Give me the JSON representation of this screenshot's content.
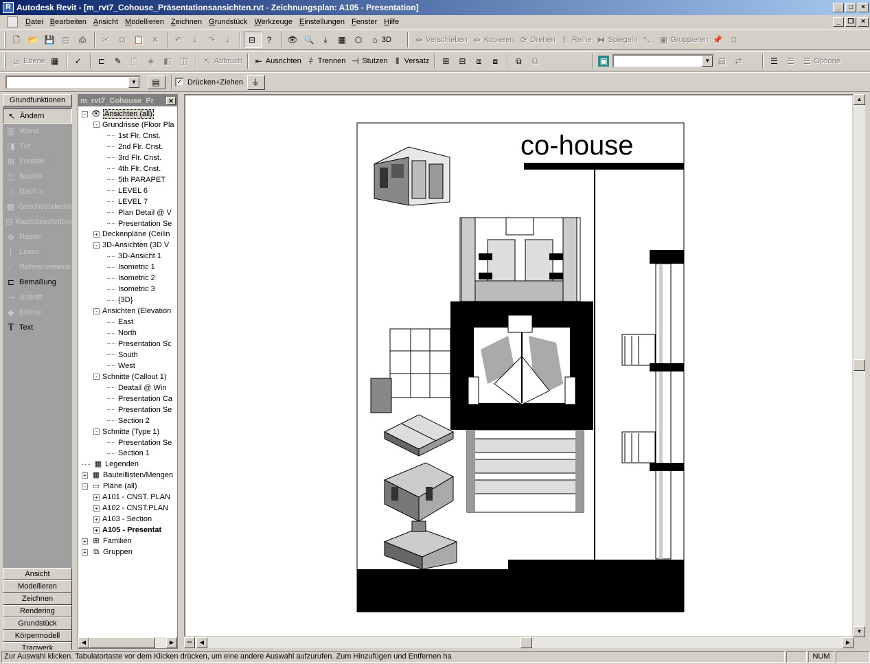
{
  "window": {
    "title": "Autodesk Revit - [m_rvt7_Cohouse_Präsentationsansichten.rvt - Zeichnungsplan: A105 - Presentation]",
    "app_icon": "R"
  },
  "menu": [
    "Datei",
    "Bearbeiten",
    "Ansicht",
    "Modellieren",
    "Zeichnen",
    "Grundstück",
    "Werkzeuge",
    "Einstellungen",
    "Fenster",
    "Hilfe"
  ],
  "toolbar1": {
    "view_3d_label": "3D",
    "verschieben": "Verschieben",
    "kopieren": "Kopieren",
    "drehen": "Drehen",
    "reihe": "Reihe",
    "spiegeln": "Spiegeln",
    "gruppieren": "Gruppieren"
  },
  "toolbar2": {
    "ebene": "Ebene",
    "abbruch": "Abbruch",
    "ausrichten": "Ausrichten",
    "trennen": "Trennen",
    "stutzen": "Stutzen",
    "versatz": "Versatz",
    "optionen": "Optione"
  },
  "toolbar3": {
    "druecken_ziehen": "Drücken+Ziehen",
    "druecken_ziehen_checked": true
  },
  "designbar": {
    "header": "Grundfunktionen",
    "items": [
      {
        "label": "Ändern",
        "state": "selected",
        "icon": "cursor-icon"
      },
      {
        "label": "Wand",
        "state": "disabled",
        "icon": "wall-icon"
      },
      {
        "label": "Tür",
        "state": "disabled",
        "icon": "door-icon"
      },
      {
        "label": "Fenster",
        "state": "disabled",
        "icon": "window-icon"
      },
      {
        "label": "Bauteil",
        "state": "disabled",
        "icon": "component-icon"
      },
      {
        "label": "Dach »",
        "state": "disabled",
        "icon": "roof-icon"
      },
      {
        "label": "Geschossdecke",
        "state": "disabled",
        "icon": "floor-icon"
      },
      {
        "label": "Raumbeschriftung",
        "state": "disabled",
        "icon": "room-tag-icon"
      },
      {
        "label": "Raster",
        "state": "disabled",
        "icon": "grid-icon"
      },
      {
        "label": "Linien",
        "state": "disabled",
        "icon": "lines-icon"
      },
      {
        "label": "Referenzebene",
        "state": "disabled",
        "icon": "ref-plane-icon"
      },
      {
        "label": "Bemaßung",
        "state": "active",
        "icon": "dimension-icon"
      },
      {
        "label": "Schnitt",
        "state": "disabled",
        "icon": "section-icon"
      },
      {
        "label": "Ebene",
        "state": "disabled",
        "icon": "level-icon"
      },
      {
        "label": "Text",
        "state": "active",
        "icon": "text-icon"
      }
    ],
    "tabs": [
      "Ansicht",
      "Modellieren",
      "Zeichnen",
      "Rendering",
      "Grundstück",
      "Körpermodell",
      "Tragwerk"
    ]
  },
  "browser": {
    "title": "m_rvt7_Cohouse_Pr",
    "tree": [
      {
        "label": "Ansichten (all)",
        "level": 0,
        "toggle": "-",
        "icon": "eye-icon",
        "selected": true
      },
      {
        "label": "Grundrisse (Floor Pla",
        "level": 1,
        "toggle": "-"
      },
      {
        "label": "1st Flr. Cnst.",
        "level": 2
      },
      {
        "label": "2nd Flr. Cnst.",
        "level": 2
      },
      {
        "label": "3rd Flr. Cnst.",
        "level": 2
      },
      {
        "label": "4th Flr. Cnst.",
        "level": 2
      },
      {
        "label": "5th PARAPET",
        "level": 2
      },
      {
        "label": "LEVEL 6",
        "level": 2
      },
      {
        "label": "LEVEL 7",
        "level": 2
      },
      {
        "label": "Plan Detail @ V",
        "level": 2
      },
      {
        "label": "Presentation Se",
        "level": 2
      },
      {
        "label": "Deckenpläne (Ceilin",
        "level": 1,
        "toggle": "+"
      },
      {
        "label": "3D-Ansichten (3D V",
        "level": 1,
        "toggle": "-"
      },
      {
        "label": "3D-Ansicht 1",
        "level": 2
      },
      {
        "label": "Isometric 1",
        "level": 2
      },
      {
        "label": "Isometric 2",
        "level": 2
      },
      {
        "label": "Isometric 3",
        "level": 2
      },
      {
        "label": "{3D}",
        "level": 2
      },
      {
        "label": "Ansichten (Elevation",
        "level": 1,
        "toggle": "-"
      },
      {
        "label": "East",
        "level": 2
      },
      {
        "label": "North",
        "level": 2
      },
      {
        "label": "Presentation Sc",
        "level": 2
      },
      {
        "label": "South",
        "level": 2
      },
      {
        "label": "West",
        "level": 2
      },
      {
        "label": "Schnitte (Callout 1)",
        "level": 1,
        "toggle": "-"
      },
      {
        "label": "Deatail @ Win",
        "level": 2
      },
      {
        "label": "Presentation Ca",
        "level": 2
      },
      {
        "label": "Presentation Se",
        "level": 2
      },
      {
        "label": "Section 2",
        "level": 2
      },
      {
        "label": "Schnitte (Type 1)",
        "level": 1,
        "toggle": "-"
      },
      {
        "label": "Presentation Se",
        "level": 2
      },
      {
        "label": "Section 1",
        "level": 2
      },
      {
        "label": "Legenden",
        "level": 0,
        "icon": "legend-icon"
      },
      {
        "label": "Bauteillisten/Mengen",
        "level": 0,
        "toggle": "+",
        "icon": "schedule-icon"
      },
      {
        "label": "Pläne (all)",
        "level": 0,
        "toggle": "-",
        "icon": "sheet-icon"
      },
      {
        "label": "A101 - CNST. PLAN",
        "level": 1,
        "toggle": "+"
      },
      {
        "label": "A102 - CNST.PLAN",
        "level": 1,
        "toggle": "+"
      },
      {
        "label": "A103 - Section",
        "level": 1,
        "toggle": "+"
      },
      {
        "label": "A105 - Presentat",
        "level": 1,
        "toggle": "+",
        "bold": true
      },
      {
        "label": "Familien",
        "level": 0,
        "toggle": "+",
        "icon": "family-icon"
      },
      {
        "label": "Gruppen",
        "level": 0,
        "toggle": "+",
        "icon": "group-icon"
      }
    ]
  },
  "sheet": {
    "title": "co-house"
  },
  "status": {
    "text": "Zur Auswahl klicken. Tabulatortaste vor dem Klicken drücken, um eine andere Auswahl aufzurufen. Zum Hinzufügen und Entfernen ha",
    "num": "NUM"
  }
}
